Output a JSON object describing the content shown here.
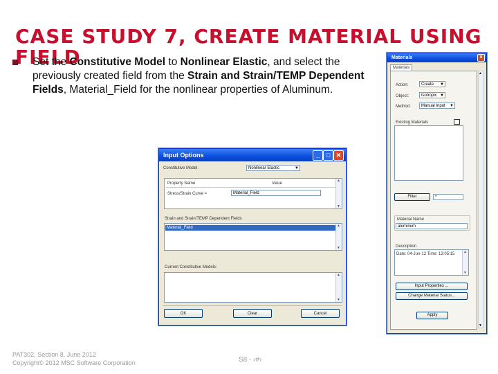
{
  "slide": {
    "title": "CASE STUDY 7, CREATE MATERIAL USING FIELD",
    "body": {
      "t1": "Set the ",
      "b1": "Constitutive Model",
      "t2": " to ",
      "b2": "Nonlinear Elastic",
      "t3": ", and select the previously created field from the ",
      "b3": "Strain and Strain/TEMP Dependent Fields",
      "t4": ", Material_Field for the nonlinear properties of Aluminum."
    },
    "footer_line1": "PAT302, Section 8, June 2012",
    "footer_line2": "Copyright© 2012 MSC Software Corporation",
    "slide_number": "S8 - ‹#›"
  },
  "input_options": {
    "title": "Input Options",
    "constitutive_model_label": "Constitutive Model:",
    "constitutive_model_value": "Nonlinear Elastic",
    "col_property_name": "Property Name",
    "col_value": "Value",
    "row_property": "Stress/Strain Curve =",
    "row_value": "Material_Field",
    "fields_label": "Strain and Strain/TEMP Dependent Fields",
    "fields_items": [
      "Material_Field"
    ],
    "current_models_label": "Current Constitutive Models:",
    "ok": "OK",
    "clear": "Clear",
    "cancel": "Cancel"
  },
  "materials": {
    "title": "Materials",
    "tab": "Materials",
    "action_label": "Action:",
    "action_value": "Create",
    "object_label": "Object:",
    "object_value": "Isotropic",
    "method_label": "Method:",
    "method_value": "Manual Input",
    "existing_label": "Existing Materials",
    "filter_button": "Filter",
    "filter_value": "*",
    "material_name_label": "Material Name",
    "material_name_value": "aluminum",
    "description_label": "Description",
    "description_text": "Date: 04-Jun-12    Time: 13:05:15",
    "input_properties_button": "Input Properties ...",
    "change_status_button": "Change Material Status...",
    "apply_button": "Apply"
  },
  "colors": {
    "title_red": "#c8102e",
    "xp_titlebar": "#0a4ee0",
    "xp_face": "#ece9d8",
    "selection": "#316ac5"
  }
}
